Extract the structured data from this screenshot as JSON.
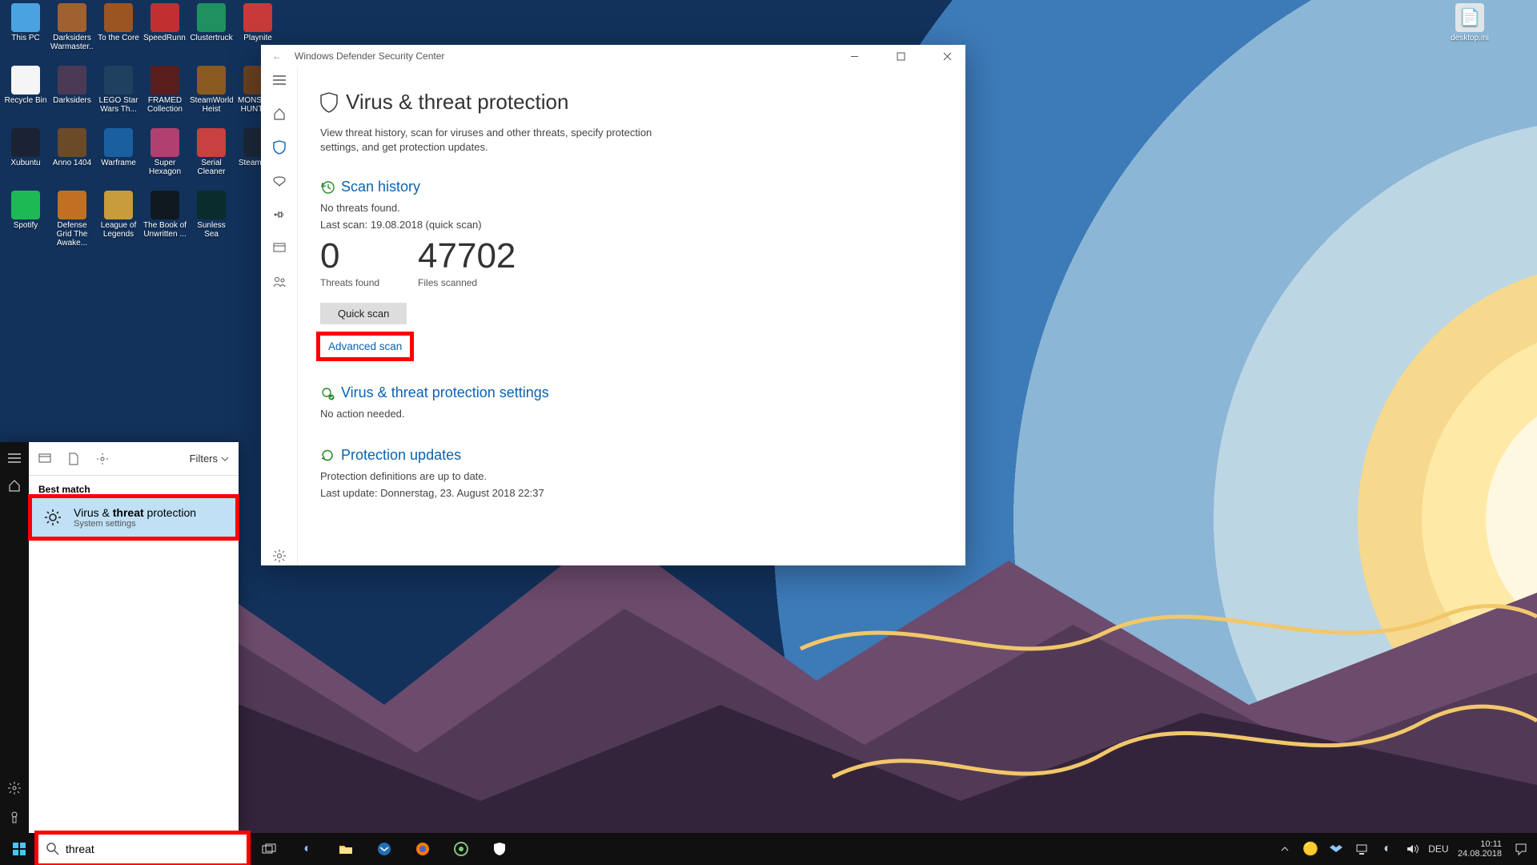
{
  "desktop_icons": [
    {
      "label": "This PC",
      "color": "#4aa3e0"
    },
    {
      "label": "Recycle Bin",
      "color": "#f5f5f5"
    },
    {
      "label": "Xubuntu",
      "color": "#1a2233"
    },
    {
      "label": "Spotify",
      "color": "#1db954"
    },
    {
      "label": "",
      "color": "transparent"
    },
    {
      "label": "Darksiders Warmaster...",
      "color": "#a06030"
    },
    {
      "label": "Darksiders",
      "color": "#4b3a55"
    },
    {
      "label": "Anno 1404",
      "color": "#6b4a2a"
    },
    {
      "label": "Defense Grid The Awake...",
      "color": "#c07020"
    },
    {
      "label": "",
      "color": "transparent"
    },
    {
      "label": "To the Core",
      "color": "#9a5522"
    },
    {
      "label": "LEGO Star Wars Th...",
      "color": "#204060"
    },
    {
      "label": "Warframe",
      "color": "#1a60a0"
    },
    {
      "label": "League of Legends",
      "color": "#c89b3c"
    },
    {
      "label": "",
      "color": "transparent"
    },
    {
      "label": "SpeedRunn...",
      "color": "#c03030"
    },
    {
      "label": "FRAMED Collection",
      "color": "#5a1e1e"
    },
    {
      "label": "Super Hexagon",
      "color": "#b04070"
    },
    {
      "label": "The Book of Unwritten ...",
      "color": "#101820"
    },
    {
      "label": "",
      "color": "transparent"
    },
    {
      "label": "Clustertruck",
      "color": "#209060"
    },
    {
      "label": "SteamWorld Heist",
      "color": "#8a5a20"
    },
    {
      "label": "Serial Cleaner",
      "color": "#c84040"
    },
    {
      "label": "Sunless Sea",
      "color": "#0b2c2c"
    },
    {
      "label": "",
      "color": "transparent"
    },
    {
      "label": "Playnite",
      "color": "#c83a3a"
    },
    {
      "label": "MONSTER HUNTE...",
      "color": "#6a4020"
    },
    {
      "label": "Steam Fl...",
      "color": "#1b2838"
    }
  ],
  "desktop_right_icon": {
    "label": "desktop.ini"
  },
  "defender": {
    "window_title": "Windows Defender Security Center",
    "page_title": "Virus & threat protection",
    "page_desc": "View threat history, scan for viruses and other threats, specify protection settings, and get protection updates.",
    "scan_history": {
      "heading": "Scan history",
      "no_threats": "No threats found.",
      "last_scan": "Last scan: 19.08.2018 (quick scan)",
      "threats_found_value": "0",
      "threats_found_label": "Threats found",
      "files_scanned_value": "47702",
      "files_scanned_label": "Files scanned",
      "quick_scan_btn": "Quick scan",
      "advanced_scan_link": "Advanced scan"
    },
    "settings": {
      "heading": "Virus & threat protection settings",
      "status": "No action needed."
    },
    "updates": {
      "heading": "Protection updates",
      "status": "Protection definitions are up to date.",
      "last_update": "Last update: Donnerstag, 23. August 2018 22:37"
    }
  },
  "search": {
    "filters_label": "Filters",
    "section_label": "Best match",
    "result_title_pre": "Virus & ",
    "result_title_bold": "threat",
    "result_title_post": " protection",
    "result_sub": "System settings",
    "input_value": "threat"
  },
  "taskbar": {
    "lang": "DEU",
    "time": "10:11",
    "date": "24.08.2018"
  }
}
